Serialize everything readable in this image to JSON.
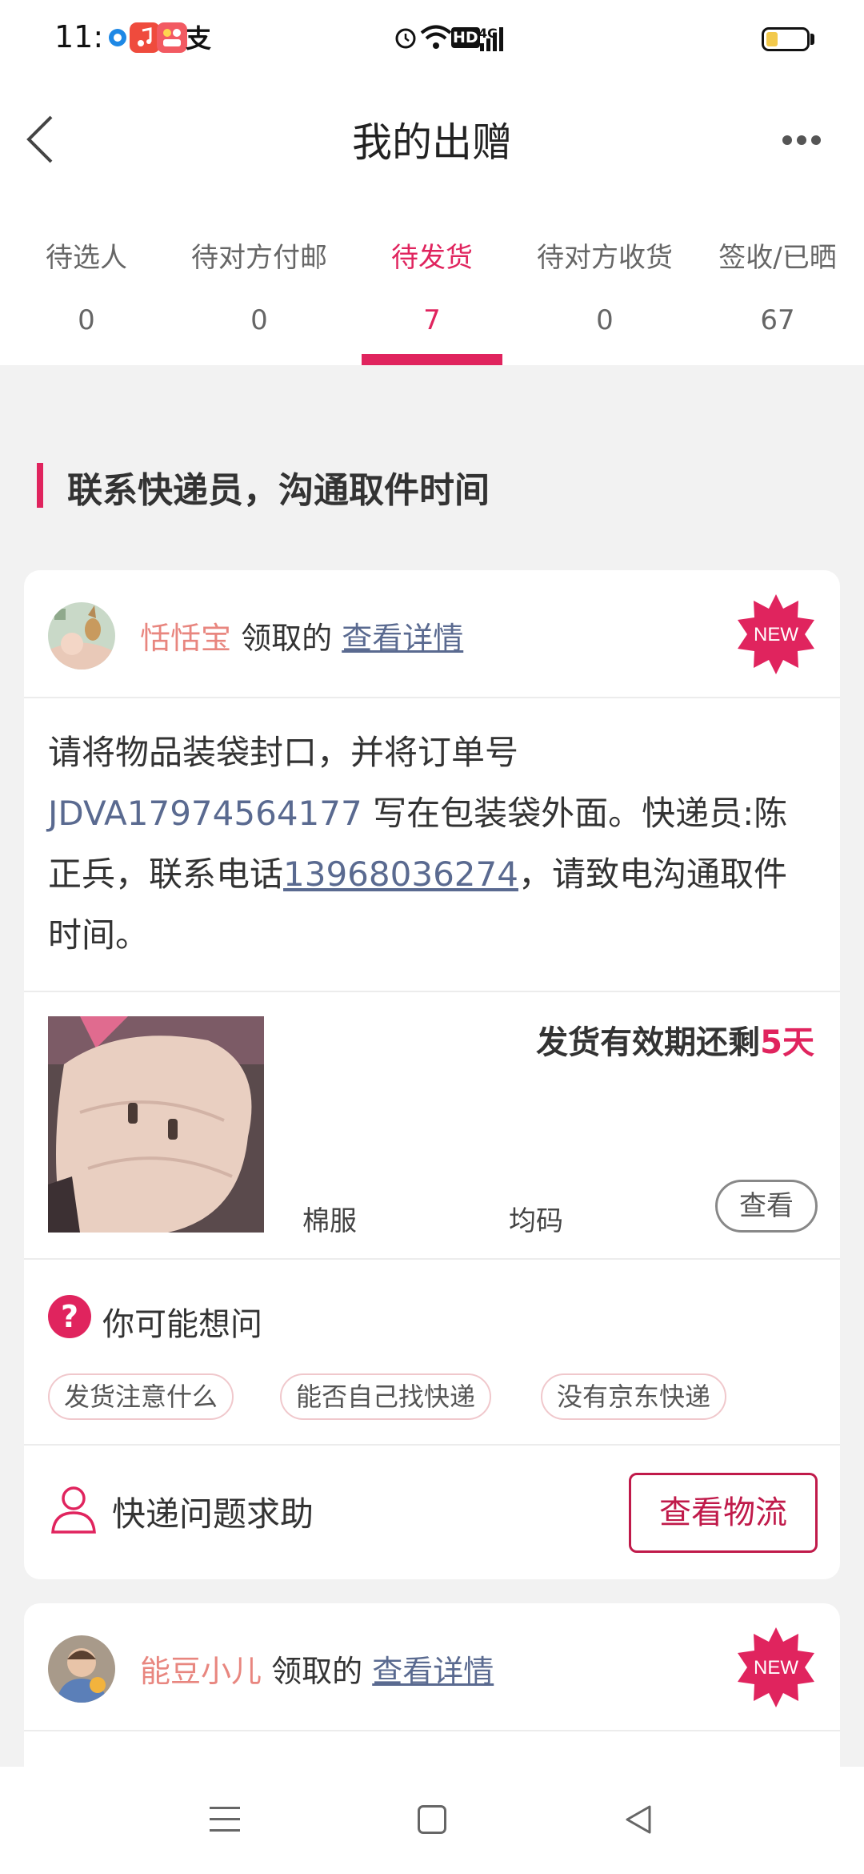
{
  "status_bar": {
    "time": "11:06",
    "icons": [
      "location-app-icon",
      "music-app-icon",
      "photo-app-icon",
      "alipay-icon",
      "alarm-icon",
      "wifi-icon",
      "hd-icon",
      "signal-4g-icon",
      "battery-icon"
    ],
    "hd": "HD",
    "network": "4G",
    "alipay_glyph": "支"
  },
  "header": {
    "title": "我的出赠"
  },
  "tabs": [
    {
      "label": "待选人",
      "count": "0",
      "active": false
    },
    {
      "label": "待对方付邮",
      "count": "0",
      "active": false
    },
    {
      "label": "待发货",
      "count": "7",
      "active": true
    },
    {
      "label": "待对方收货",
      "count": "0",
      "active": false
    },
    {
      "label": "签收/已晒",
      "count": "67",
      "active": false
    }
  ],
  "section": {
    "title": "联系快递员，沟通取件时间"
  },
  "card1": {
    "recipient": "恬恬宝",
    "claimed_text": "领取的",
    "details_link": "查看详情",
    "new_badge": "NEW",
    "instruction_prefix": "请将物品装袋封口，并将订单号",
    "order_number": "JDVA17974564177",
    "instruction_mid": "写在包装袋外面。快递员:陈正兵，联系电话",
    "phone": "13968036274",
    "instruction_suffix": "，请致电沟通取件时间。",
    "deadline_prefix": "发货有效期还剩",
    "deadline_days": "5天",
    "item_name": "棉服",
    "item_size": "均码",
    "view_button": "查看",
    "faq_icon": "?",
    "faq_title": "你可能想问",
    "faq_chips": [
      "发货注意什么",
      "能否自己找快递",
      "没有京东快递"
    ],
    "help_text": "快递问题求助",
    "track_button": "查看物流"
  },
  "card2": {
    "recipient": "能豆小儿",
    "claimed_text": "领取的",
    "details_link": "查看详情",
    "new_badge": "NEW"
  },
  "colors": {
    "accent": "#e0245e",
    "link": "#5a6a90",
    "name": "#e8867f",
    "background": "#f2f2f2"
  }
}
